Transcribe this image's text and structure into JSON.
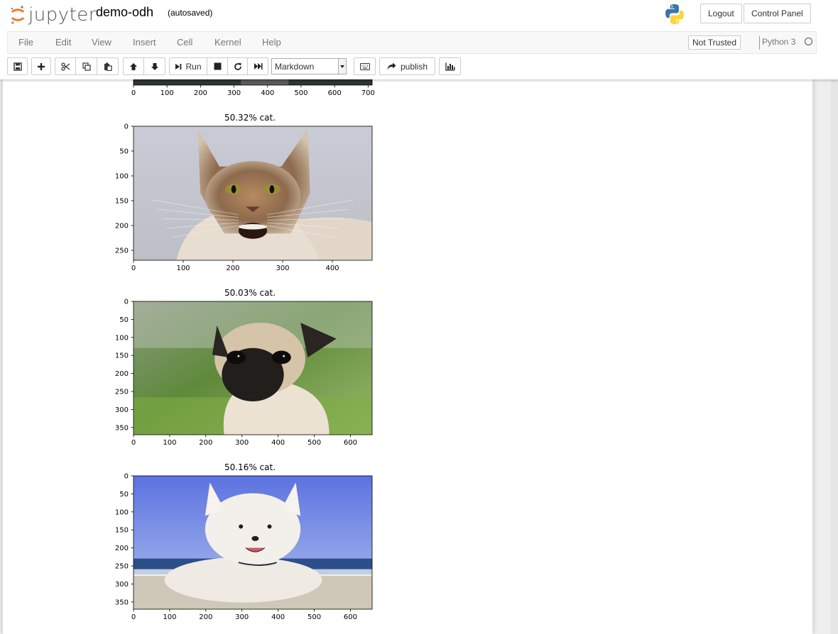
{
  "header": {
    "logo_text": "jupyter",
    "notebook_name": "demo-odh",
    "autosave_status": "(autosaved)",
    "logout_label": "Logout",
    "control_panel_label": "Control Panel"
  },
  "menubar": {
    "items": [
      "File",
      "Edit",
      "View",
      "Insert",
      "Cell",
      "Kernel",
      "Help"
    ],
    "trust_label": "Not Trusted",
    "kernel_name": "Python 3"
  },
  "toolbar": {
    "run_label": "Run",
    "cell_type": "Markdown",
    "publish_label": "publish",
    "icons": [
      "save-icon",
      "plus-icon",
      "cut-icon",
      "copy-icon",
      "paste-icon",
      "arrow-up-icon",
      "arrow-down-icon",
      "step-forward-icon",
      "stop-icon",
      "refresh-icon",
      "fast-forward-icon",
      "keyboard-icon",
      "share-icon",
      "bar-chart-icon"
    ]
  },
  "output": {
    "partial_figure": {
      "x_ticks": [
        "0",
        "100",
        "200",
        "300",
        "400",
        "500",
        "600",
        "700"
      ],
      "x_range": [
        0,
        712
      ]
    },
    "figures": [
      {
        "title": "50.32% cat.",
        "image": "maine-coon-cat",
        "x_range": [
          0,
          480
        ],
        "y_range": [
          0,
          270
        ],
        "x_ticks": [
          "0",
          "100",
          "200",
          "300",
          "400"
        ],
        "y_ticks": [
          "0",
          "50",
          "100",
          "150",
          "200",
          "250"
        ]
      },
      {
        "title": "50.03% cat.",
        "image": "pug-puppy",
        "x_range": [
          0,
          660
        ],
        "y_range": [
          0,
          370
        ],
        "x_ticks": [
          "0",
          "100",
          "200",
          "300",
          "400",
          "500",
          "600"
        ],
        "y_ticks": [
          "0",
          "50",
          "100",
          "150",
          "200",
          "250",
          "300",
          "350"
        ]
      },
      {
        "title": "50.16% cat.",
        "image": "white-puppy-on-beach",
        "x_range": [
          0,
          660
        ],
        "y_range": [
          0,
          370
        ],
        "x_ticks": [
          "0",
          "100",
          "200",
          "300",
          "400",
          "500",
          "600"
        ],
        "y_ticks": [
          "0",
          "50",
          "100",
          "150",
          "200",
          "250",
          "300",
          "350"
        ]
      }
    ]
  }
}
